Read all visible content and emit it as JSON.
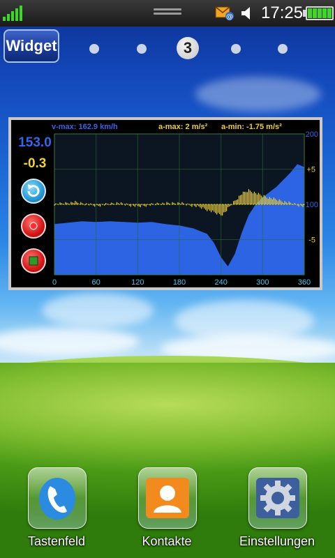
{
  "status_bar": {
    "signal_icon": "signal-strength-icon",
    "message_icon": "message-notification-icon",
    "sound_icon": "speaker-icon",
    "time": "17:25",
    "battery_icon": "battery-full-icon"
  },
  "home": {
    "widget_button_label": "Widget",
    "current_page": "3",
    "page_count": 5
  },
  "speed_widget": {
    "current_speed": "153.0",
    "current_accel": "-0.3",
    "stats": {
      "v_max": "v-max: 162.9 km/h",
      "a_max": "a-max: 2 m/s²",
      "a_min": "a-min: -1.75 m/s²"
    },
    "controls": [
      "reset-button",
      "record-button",
      "stop-button"
    ],
    "colors": {
      "speed": "#2f68ee",
      "accel": "#f2d12a",
      "axis_x": "#49c8e6",
      "grid": "#2a6b2f"
    }
  },
  "chart_data": {
    "type": "area",
    "x_ticks": [
      "0",
      "60",
      "120",
      "180",
      "240",
      "300",
      "360"
    ],
    "xlim": [
      0,
      360
    ],
    "y_left_ticks": [
      "200",
      "100"
    ],
    "ylim_speed": [
      0,
      200
    ],
    "y_right_ticks": [
      "+5",
      "-5"
    ],
    "ylim_accel": [
      -10,
      10
    ],
    "grid": true,
    "series": [
      {
        "color": "#2f68ee",
        "x": [
          0,
          20,
          40,
          60,
          80,
          100,
          120,
          140,
          160,
          180,
          200,
          220,
          230,
          240,
          250,
          260,
          270,
          280,
          290,
          300,
          320,
          340,
          350,
          360
        ],
        "values": [
          72,
          74,
          76,
          75,
          76,
          75,
          74,
          75,
          72,
          70,
          66,
          58,
          45,
          25,
          12,
          30,
          60,
          85,
          100,
          110,
          125,
          145,
          157,
          153
        ]
      },
      {
        "color": "#f2d12a",
        "x": [
          0,
          30,
          60,
          90,
          120,
          150,
          180,
          210,
          240,
          245,
          255,
          270,
          280,
          300,
          330,
          360
        ],
        "values": [
          0,
          0.3,
          -0.2,
          0.2,
          -0.3,
          0.1,
          0.2,
          -0.4,
          -1.5,
          -1.2,
          0,
          1.5,
          2,
          1.2,
          0.4,
          -0.3
        ]
      }
    ]
  },
  "dock": [
    {
      "label": "Tastenfeld",
      "icon": "phone-icon"
    },
    {
      "label": "Kontakte",
      "icon": "contacts-icon"
    },
    {
      "label": "Einstellungen",
      "icon": "settings-gear-icon"
    }
  ]
}
